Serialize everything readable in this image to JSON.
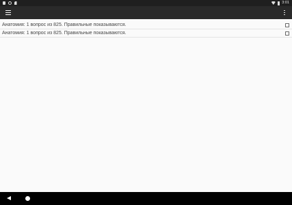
{
  "status_bar": {
    "time": "3:01",
    "left_icons": [
      "notification-square-icon",
      "sync-circle-icon",
      "sd-card-icon"
    ],
    "right_icons": [
      "wifi-icon",
      "battery-icon"
    ]
  },
  "app_bar": {
    "menu_icon": "hamburger-menu-icon",
    "overflow_icon": "more-vert-icon"
  },
  "list": {
    "items": [
      {
        "text": "Анатомия: 1 вопрос из 825. Правильные показываются.",
        "checked": false
      },
      {
        "text": "Анатомия: 1 вопрос из 825. Правильные показываются.",
        "checked": false
      }
    ]
  },
  "nav_bar": {
    "buttons": [
      "back-icon",
      "home-icon"
    ]
  },
  "colors": {
    "status_bar": "#1f1f1f",
    "app_bar": "#2a2a2a",
    "background": "#fafafa",
    "nav_bar": "#000000"
  }
}
